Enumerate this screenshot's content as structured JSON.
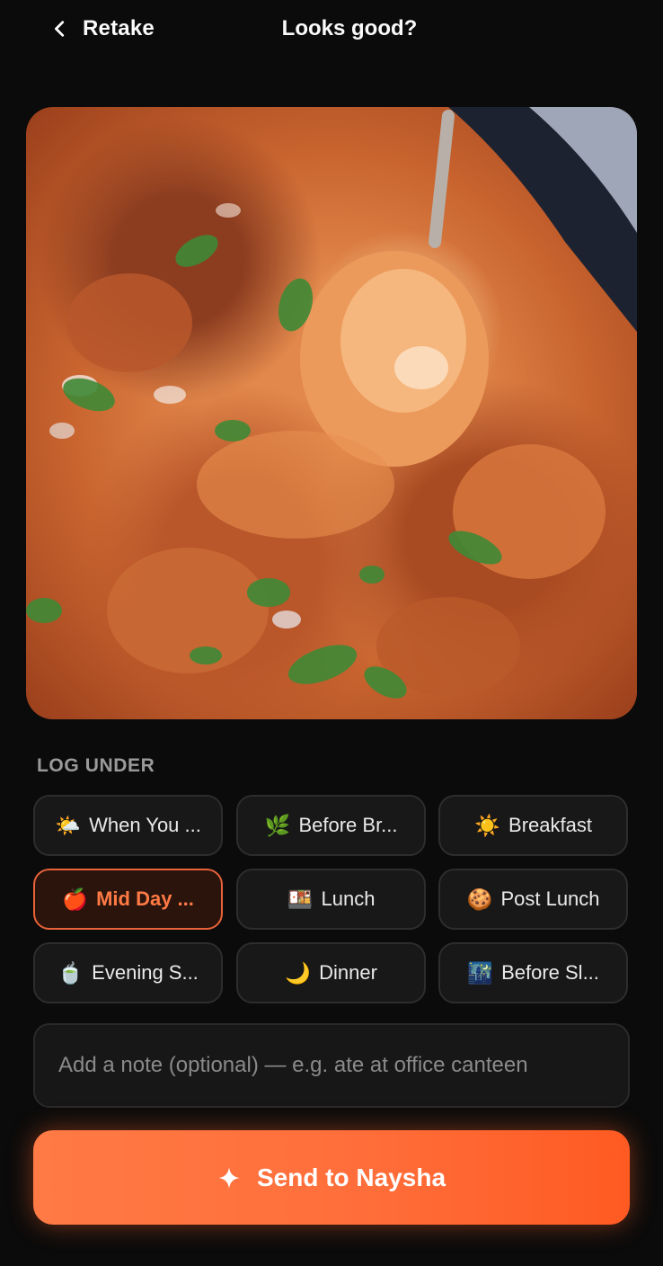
{
  "header": {
    "back_label": "Retake",
    "title": "Looks good?"
  },
  "photo": {
    "alt": "Photo of curry"
  },
  "log_under": {
    "label": "LOG UNDER",
    "selected": "Mid Day ...",
    "options": [
      {
        "icon": "sun-behind-cloud-icon",
        "emoji": "🌤️",
        "label": "When You ..."
      },
      {
        "icon": "herb-icon",
        "emoji": "🌿",
        "label": "Before Br..."
      },
      {
        "icon": "sun-icon",
        "emoji": "☀️",
        "label": "Breakfast"
      },
      {
        "icon": "apple-icon",
        "emoji": "🍎",
        "label": "Mid Day ..."
      },
      {
        "icon": "bento-box-icon",
        "emoji": "🍱",
        "label": "Lunch"
      },
      {
        "icon": "cookie-icon",
        "emoji": "🍪",
        "label": "Post Lunch"
      },
      {
        "icon": "tea-cup-icon",
        "emoji": "🍵",
        "label": "Evening S..."
      },
      {
        "icon": "crescent-moon-icon",
        "emoji": "🌙",
        "label": "Dinner"
      },
      {
        "icon": "night-city-icon",
        "emoji": "🌃",
        "label": "Before Sl..."
      }
    ]
  },
  "note": {
    "placeholder": "Add a note (optional) — e.g. ate at office canteen",
    "value": ""
  },
  "send": {
    "label": "Send to Naysha"
  },
  "colors": {
    "background": "#0b0b0b",
    "accent": "#ff6e3a",
    "active_chip_border": "#e8623a",
    "active_chip_text": "#ff7a45"
  }
}
